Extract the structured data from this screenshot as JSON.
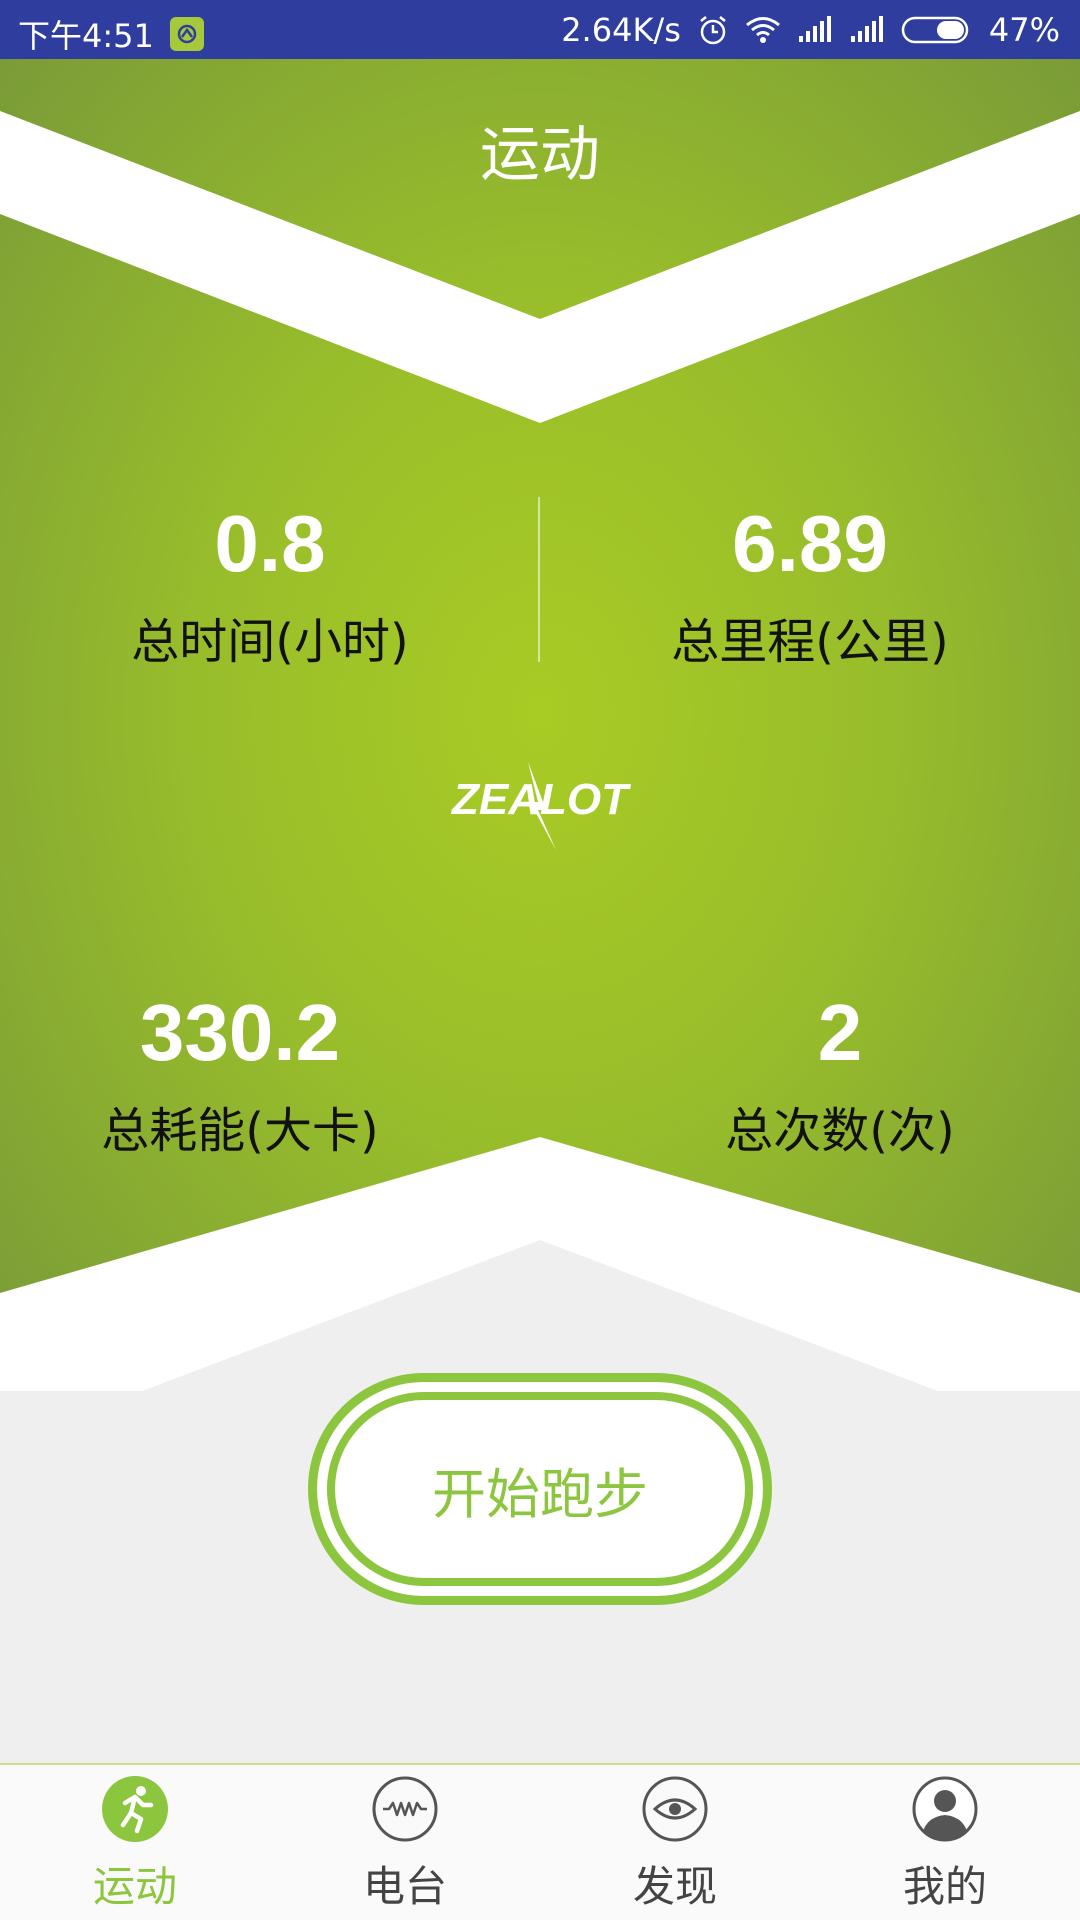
{
  "status_bar": {
    "time": "下午4:51",
    "network_speed": "2.64K/s",
    "battery": "47%",
    "icons": [
      "app-notification-icon",
      "alarm-icon",
      "wifi-icon",
      "signal-icon",
      "battery-icon"
    ]
  },
  "page": {
    "title": "运动"
  },
  "stats": {
    "total_time": {
      "value": "0.8",
      "label": "总时间(小时)"
    },
    "total_distance": {
      "value": "6.89",
      "label": "总里程(公里)"
    },
    "total_energy": {
      "value": "330.2",
      "label": "总耗能(大卡)"
    },
    "total_count": {
      "value": "2",
      "label": "总次数(次)"
    }
  },
  "logo_text": "ZEALOT",
  "start_button": {
    "label": "开始跑步"
  },
  "bottom_nav": {
    "items": [
      {
        "label": "运动",
        "icon": "run-icon",
        "active": true
      },
      {
        "label": "电台",
        "icon": "radio-icon",
        "active": false
      },
      {
        "label": "发现",
        "icon": "eye-icon",
        "active": false
      },
      {
        "label": "我的",
        "icon": "profile-icon",
        "active": false
      }
    ]
  },
  "colors": {
    "status_bar": "#2f3e9e",
    "hero_light": "#a8cc24",
    "hero_dark": "#799a38",
    "accent": "#8cc63f",
    "background": "#efefef"
  }
}
